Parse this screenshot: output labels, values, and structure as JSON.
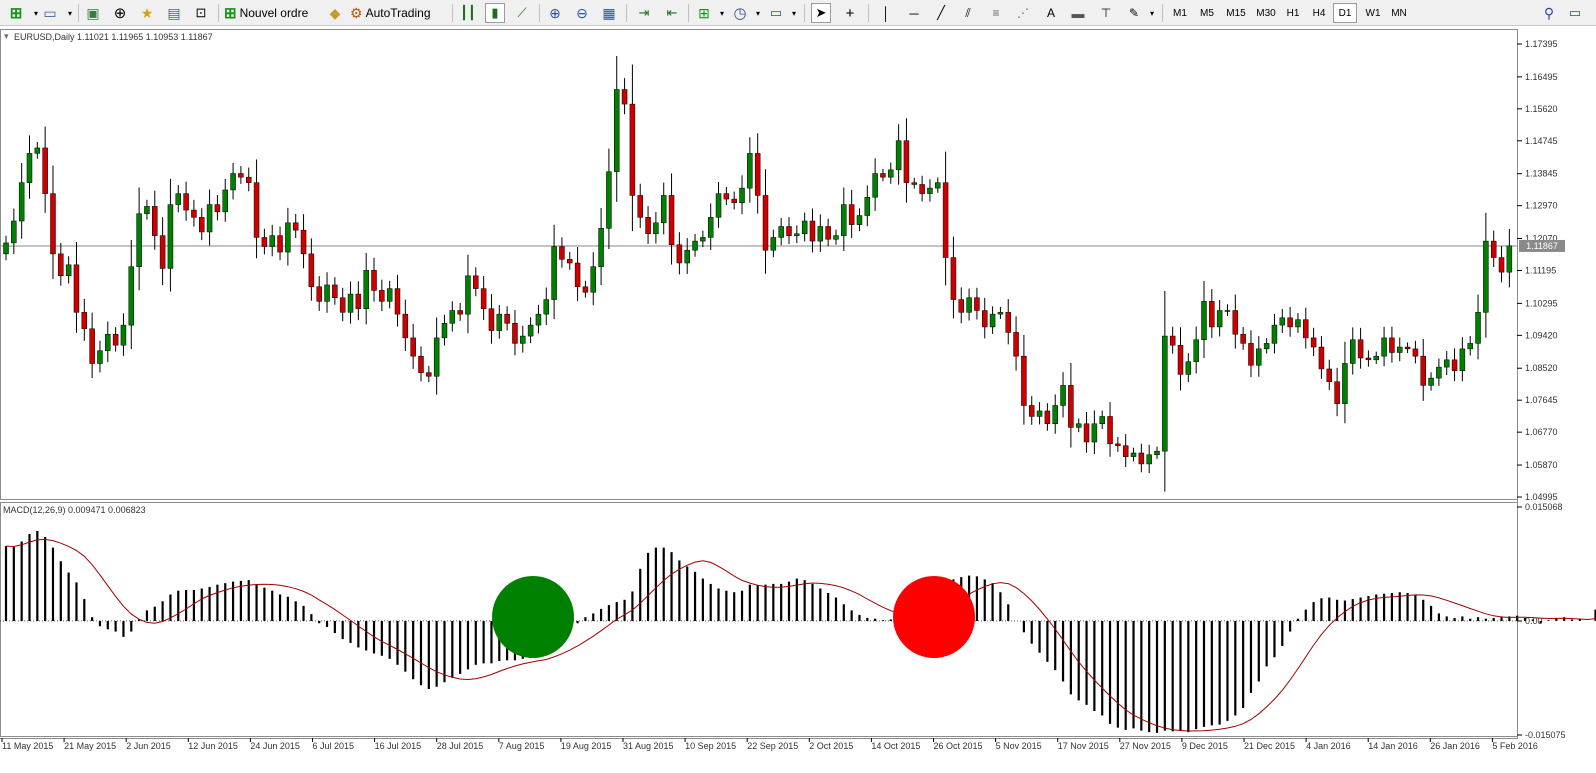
{
  "toolbar": {
    "new_order_label": "Nouvel ordre",
    "autotrading_label": "AutoTrading",
    "timeframes": [
      "M1",
      "M5",
      "M15",
      "M30",
      "H1",
      "H4",
      "D1",
      "W1",
      "MN"
    ],
    "active_timeframe": "D1",
    "text_tool_label": "A"
  },
  "price_panel": {
    "symbol_info": "EURUSD,Daily  1.11021 1.11965 1.10953 1.11867",
    "current_price_label": "1.11867",
    "current_price": 1.11867
  },
  "macd_panel": {
    "label": "MACD(12,26,9) 0.009471 0.006823",
    "markers": [
      {
        "name": "bullish-signal",
        "color": "#008000",
        "date": "10 Aug 2015"
      },
      {
        "name": "bearish-signal",
        "color": "#ff0000",
        "date": "21 Oct 2015"
      }
    ]
  },
  "chart_data": {
    "type": "candlestick",
    "symbol": "EURUSD",
    "timeframe": "Daily",
    "price_axis": {
      "ticks": [
        "1.17395",
        "1.16495",
        "1.15620",
        "1.14745",
        "1.13845",
        "1.12970",
        "1.12070",
        "1.11195",
        "1.10295",
        "1.09420",
        "1.08520",
        "1.07645",
        "1.06770",
        "1.05870",
        "1.04995"
      ],
      "ylim": [
        1.04995,
        1.17395
      ]
    },
    "macd_axis": {
      "ticks": [
        "0.015068",
        "0.00",
        "-0.015075"
      ],
      "ylim": [
        -0.015075,
        0.015068
      ],
      "fast": 12,
      "slow": 26,
      "signal": 9
    },
    "x_ticks": [
      "11 May 2015",
      "21 May 2015",
      "2 Jun 2015",
      "12 Jun 2015",
      "24 Jun 2015",
      "6 Jul 2015",
      "16 Jul 2015",
      "28 Jul 2015",
      "7 Aug 2015",
      "19 Aug 2015",
      "31 Aug 2015",
      "10 Sep 2015",
      "22 Sep 2015",
      "2 Oct 2015",
      "14 Oct 2015",
      "26 Oct 2015",
      "5 Nov 2015",
      "17 Nov 2015",
      "27 Nov 2015",
      "9 Dec 2015",
      "21 Dec 2015",
      "4 Jan 2016",
      "14 Jan 2016",
      "26 Jan 2016",
      "5 Feb 2016"
    ],
    "colors": {
      "bull": "#008000",
      "bear": "#cc0000",
      "signal_line": "#a00000",
      "macd_bars": "#000000"
    },
    "closes": [
      1.1195,
      1.1255,
      1.136,
      1.144,
      1.1455,
      1.133,
      1.1165,
      1.1105,
      1.1135,
      1.1005,
      1.096,
      1.0865,
      1.09,
      1.0945,
      1.0915,
      1.097,
      1.113,
      1.1275,
      1.1295,
      1.1215,
      1.1125,
      1.13,
      1.133,
      1.1285,
      1.1265,
      1.1225,
      1.13,
      1.128,
      1.134,
      1.1385,
      1.1375,
      1.136,
      1.121,
      1.1185,
      1.1215,
      1.117,
      1.125,
      1.123,
      1.1165,
      1.1075,
      1.1035,
      1.108,
      1.1045,
      1.1005,
      1.1055,
      1.1015,
      1.112,
      1.1065,
      1.1035,
      1.107,
      1.1,
      1.0935,
      1.0885,
      1.084,
      1.083,
      1.0935,
      1.0975,
      1.101,
      1.1,
      1.1105,
      1.107,
      1.1015,
      1.0955,
      1.1,
      1.0975,
      1.092,
      1.094,
      1.097,
      1.1,
      1.104,
      1.1185,
      1.115,
      1.114,
      1.1075,
      1.106,
      1.113,
      1.1235,
      1.139,
      1.1615,
      1.1575,
      1.1325,
      1.1265,
      1.122,
      1.125,
      1.1325,
      1.119,
      1.114,
      1.1175,
      1.12,
      1.121,
      1.1265,
      1.133,
      1.1315,
      1.1305,
      1.1345,
      1.144,
      1.1325,
      1.1175,
      1.121,
      1.124,
      1.1215,
      1.122,
      1.1255,
      1.12,
      1.124,
      1.1205,
      1.1215,
      1.13,
      1.1245,
      1.127,
      1.132,
      1.1385,
      1.1375,
      1.1395,
      1.1475,
      1.136,
      1.1355,
      1.133,
      1.1345,
      1.136,
      1.1155,
      1.104,
      1.1005,
      1.1045,
      1.101,
      1.0965,
      1.1,
      1.1005,
      1.095,
      1.0885,
      1.075,
      1.072,
      1.0735,
      1.07,
      1.075,
      1.0805,
      1.069,
      1.07,
      1.065,
      1.07,
      1.072,
      1.0645,
      1.064,
      1.061,
      1.062,
      1.059,
      1.0615,
      1.0625,
      1.094,
      1.0915,
      1.0835,
      1.087,
      1.093,
      1.1035,
      1.0965,
      1.101,
      1.101,
      1.0945,
      1.092,
      1.086,
      1.0905,
      1.092,
      1.097,
      1.099,
      1.0965,
      1.0985,
      1.0935,
      1.091,
      1.085,
      1.0815,
      1.0755,
      1.0865,
      1.093,
      1.088,
      1.0875,
      1.0885,
      1.0935,
      1.0895,
      1.091,
      1.0905,
      1.0885,
      1.0805,
      1.0825,
      1.0855,
      1.0875,
      1.0845,
      1.0905,
      1.092,
      1.1005,
      1.12,
      1.1155,
      1.1115,
      1.1187
    ],
    "macd_histogram": [
      0.0099,
      0.0098,
      0.0105,
      0.0115,
      0.0119,
      0.0111,
      0.0097,
      0.0079,
      0.0064,
      0.0051,
      0.0029,
      0.0005,
      -0.0007,
      -0.0011,
      -0.0014,
      -0.0021,
      -0.0014,
      0.0002,
      0.0014,
      0.0019,
      0.0026,
      0.0035,
      0.004,
      0.0041,
      0.0041,
      0.0043,
      0.0045,
      0.0048,
      0.005,
      0.0052,
      0.0053,
      0.0054,
      0.0048,
      0.0044,
      0.004,
      0.0035,
      0.0032,
      0.0026,
      0.002,
      0.0009,
      -0.0003,
      -0.0008,
      -0.0016,
      -0.0024,
      -0.0029,
      -0.0035,
      -0.0039,
      -0.0043,
      -0.0046,
      -0.005,
      -0.0058,
      -0.0067,
      -0.0077,
      -0.0085,
      -0.009,
      -0.0087,
      -0.0081,
      -0.0075,
      -0.007,
      -0.0064,
      -0.0058,
      -0.0056,
      -0.0056,
      -0.0053,
      -0.0052,
      -0.0052,
      -0.005,
      -0.0049,
      -0.0047,
      -0.0043,
      -0.0026,
      -0.0018,
      -0.001,
      -0.0003,
      0.0005,
      0.001,
      0.0016,
      0.0021,
      0.0025,
      0.0028,
      0.0039,
      0.0069,
      0.009,
      0.0097,
      0.0097,
      0.0091,
      0.008,
      0.0072,
      0.0065,
      0.0056,
      0.0049,
      0.0043,
      0.004,
      0.0038,
      0.004,
      0.0048,
      0.0047,
      0.0048,
      0.0049,
      0.0049,
      0.0052,
      0.0056,
      0.0054,
      0.0049,
      0.0043,
      0.0037,
      0.0031,
      0.0022,
      0.0014,
      0.0008,
      0.0004,
      0.0003,
      0.0001,
      0.0002,
      0.0006,
      0.001,
      0.0014,
      0.0018,
      0.0024,
      0.0033,
      0.0048,
      0.0055,
      0.0058,
      0.006,
      0.0059,
      0.0055,
      0.005,
      0.0038,
      0.0022,
      0.0,
      -0.0015,
      -0.003,
      -0.0042,
      -0.0054,
      -0.0065,
      -0.008,
      -0.0097,
      -0.0105,
      -0.0111,
      -0.0119,
      -0.0125,
      -0.0136,
      -0.0141,
      -0.0144,
      -0.0142,
      -0.0145,
      -0.0147,
      -0.0148,
      -0.0145,
      -0.0146,
      -0.0145,
      -0.0147,
      -0.0143,
      -0.014,
      -0.0138,
      -0.0137,
      -0.0132,
      -0.0125,
      -0.0115,
      -0.0095,
      -0.008,
      -0.006,
      -0.0048,
      -0.0033,
      -0.0014,
      0.0003,
      0.0015,
      0.0025,
      0.003,
      0.0031,
      0.0028,
      0.0027,
      0.0029,
      0.0031,
      0.0033,
      0.0035,
      0.0036,
      0.0037,
      0.0038,
      0.0037,
      0.0034,
      0.0028,
      0.002,
      0.001,
      0.0006,
      0.0004,
      0.0006,
      0.0003,
      0.0005,
      0.0003,
      0.0004,
      0.0006,
      0.0006,
      0.0007,
      0.0004,
      0.0002,
      -0.0003,
      0.0001,
      0.0004,
      0.0005,
      0.0002,
      0.0002,
      0.0,
      0.0015,
      0.0023,
      0.0054,
      0.0062,
      0.0075
    ]
  }
}
